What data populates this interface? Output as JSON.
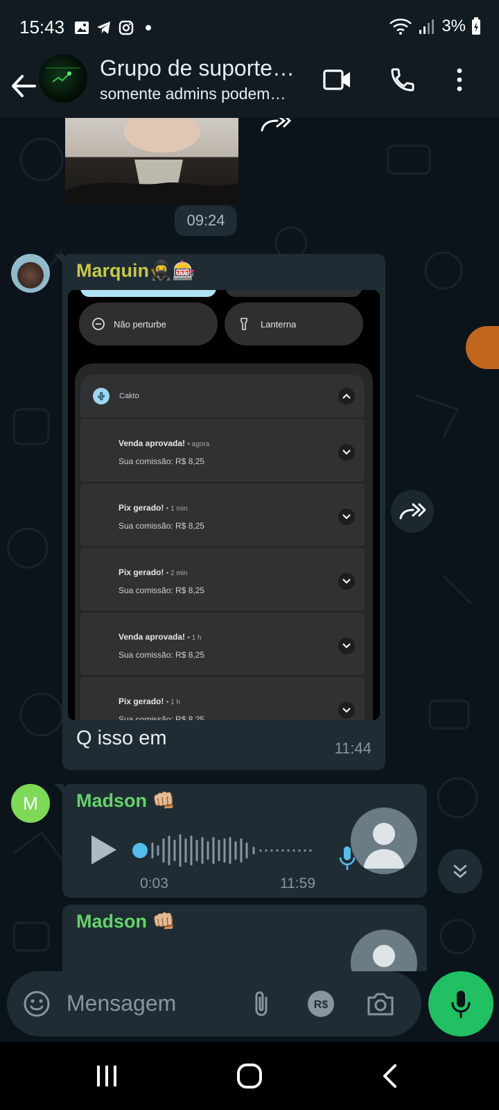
{
  "status_bar": {
    "time": "15:43",
    "battery": "3%",
    "icons": [
      "gallery-icon",
      "telegram-icon",
      "instagram-icon",
      "dot-icon",
      "wifi-icon",
      "signal-icon",
      "battery-charging-icon"
    ]
  },
  "header": {
    "title": "Grupo de suporte…",
    "subtitle": "somente admins podem…",
    "icons": [
      "back-arrow-icon",
      "video-call-icon",
      "phone-icon",
      "more-vertical-icon"
    ]
  },
  "chat": {
    "date_chip": "09:24",
    "messages": [
      {
        "sender": "Marquin🥷🎰",
        "sender_color": "#c8c84a",
        "caption": "Q isso em",
        "time": "11:44",
        "screenshot": {
          "quick_tiles": [
            "Não perturbe",
            "Lanterna"
          ],
          "app_name": "Cakto",
          "notifications": [
            {
              "title": "Venda aprovada!",
              "age": "• agora",
              "body": "Sua comissão: R$ 8,25"
            },
            {
              "title": "Pix gerado!",
              "age": "• 1 min",
              "body": "Sua comissão: R$ 8,25"
            },
            {
              "title": "Pix gerado!",
              "age": "• 2 min",
              "body": "Sua comissão: R$ 8,25"
            },
            {
              "title": "Venda aprovada!",
              "age": "• 1 h",
              "body": "Sua comissão: R$ 8,25"
            },
            {
              "title": "Pix gerado!",
              "age": "• 1 h",
              "body": "Sua comissão: R$ 8,25"
            }
          ]
        }
      },
      {
        "sender": "Madson 👊🏼",
        "sender_color": "#63d46a",
        "avatar_letter": "M",
        "voice": {
          "duration": "0:03",
          "time": "11:59"
        }
      },
      {
        "sender": "Madson 👊🏼",
        "sender_color": "#63d46a"
      }
    ]
  },
  "composer": {
    "placeholder": "Mensagem",
    "icons": [
      "emoji-icon",
      "attach-icon",
      "payment-icon",
      "camera-icon",
      "mic-icon"
    ]
  },
  "accent": "#21c063"
}
